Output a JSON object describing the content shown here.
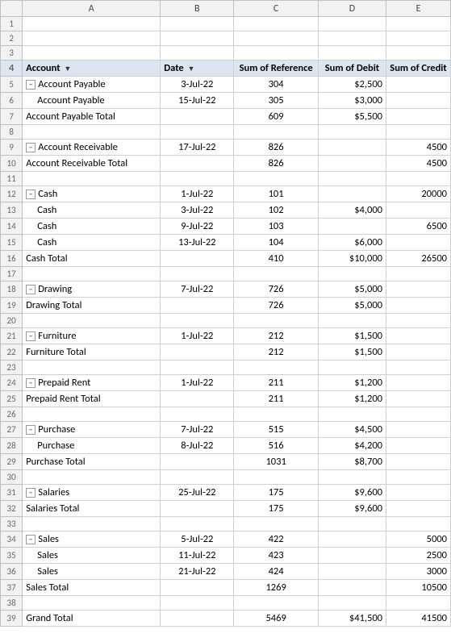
{
  "columns": {
    "rownum": "#",
    "a": "A",
    "b": "B",
    "c": "C",
    "d": "D",
    "e": "E"
  },
  "header": {
    "account": "Account",
    "date": "Date",
    "sum_ref": "Sum of Reference",
    "sum_debit": "Sum of Debit",
    "sum_credit": "Sum of Credit"
  },
  "rows": [
    {
      "num": "1",
      "type": "empty"
    },
    {
      "num": "2",
      "type": "empty"
    },
    {
      "num": "3",
      "type": "empty"
    },
    {
      "num": "4",
      "type": "header"
    },
    {
      "num": "5",
      "type": "account_group",
      "a": "Account Payable",
      "b": "3-Jul-22",
      "c": "304",
      "d": "$2,500",
      "e": ""
    },
    {
      "num": "6",
      "type": "account_sub",
      "a": "Account Payable",
      "b": "15-Jul-22",
      "c": "305",
      "d": "$3,000",
      "e": ""
    },
    {
      "num": "7",
      "type": "total",
      "a": "Account Payable  Total",
      "b": "",
      "c": "609",
      "d": "$5,500",
      "e": ""
    },
    {
      "num": "8",
      "type": "empty"
    },
    {
      "num": "9",
      "type": "account_group",
      "a": "Account Receivable",
      "b": "17-Jul-22",
      "c": "826",
      "d": "",
      "e": "4500"
    },
    {
      "num": "10",
      "type": "total",
      "a": "Account Receivable  Total",
      "b": "",
      "c": "826",
      "d": "",
      "e": "4500"
    },
    {
      "num": "11",
      "type": "empty"
    },
    {
      "num": "12",
      "type": "account_group",
      "a": "Cash",
      "b": "1-Jul-22",
      "c": "101",
      "d": "",
      "e": "20000"
    },
    {
      "num": "13",
      "type": "account_sub",
      "a": "Cash",
      "b": "3-Jul-22",
      "c": "102",
      "d": "$4,000",
      "e": ""
    },
    {
      "num": "14",
      "type": "account_sub",
      "a": "Cash",
      "b": "9-Jul-22",
      "c": "103",
      "d": "",
      "e": "6500"
    },
    {
      "num": "15",
      "type": "account_sub",
      "a": "Cash",
      "b": "13-Jul-22",
      "c": "104",
      "d": "$6,000",
      "e": ""
    },
    {
      "num": "16",
      "type": "total",
      "a": "Cash  Total",
      "b": "",
      "c": "410",
      "d": "$10,000",
      "e": "26500"
    },
    {
      "num": "17",
      "type": "empty"
    },
    {
      "num": "18",
      "type": "account_group",
      "a": "Drawing",
      "b": "7-Jul-22",
      "c": "726",
      "d": "$5,000",
      "e": ""
    },
    {
      "num": "19",
      "type": "total",
      "a": "Drawing  Total",
      "b": "",
      "c": "726",
      "d": "$5,000",
      "e": ""
    },
    {
      "num": "20",
      "type": "empty"
    },
    {
      "num": "21",
      "type": "account_group",
      "a": "Furniture",
      "b": "1-Jul-22",
      "c": "212",
      "d": "$1,500",
      "e": ""
    },
    {
      "num": "22",
      "type": "total",
      "a": "Furniture  Total",
      "b": "",
      "c": "212",
      "d": "$1,500",
      "e": ""
    },
    {
      "num": "23",
      "type": "empty"
    },
    {
      "num": "24",
      "type": "account_group",
      "a": "Prepaid Rent",
      "b": "1-Jul-22",
      "c": "211",
      "d": "$1,200",
      "e": ""
    },
    {
      "num": "25",
      "type": "total",
      "a": "Prepaid Rent  Total",
      "b": "",
      "c": "211",
      "d": "$1,200",
      "e": ""
    },
    {
      "num": "26",
      "type": "empty"
    },
    {
      "num": "27",
      "type": "account_group",
      "a": "Purchase",
      "b": "7-Jul-22",
      "c": "515",
      "d": "$4,500",
      "e": ""
    },
    {
      "num": "28",
      "type": "account_sub",
      "a": "Purchase",
      "b": "8-Jul-22",
      "c": "516",
      "d": "$4,200",
      "e": ""
    },
    {
      "num": "29",
      "type": "total",
      "a": "Purchase  Total",
      "b": "",
      "c": "1031",
      "d": "$8,700",
      "e": ""
    },
    {
      "num": "30",
      "type": "empty"
    },
    {
      "num": "31",
      "type": "account_group",
      "a": "Salaries",
      "b": "25-Jul-22",
      "c": "175",
      "d": "$9,600",
      "e": ""
    },
    {
      "num": "32",
      "type": "total",
      "a": "Salaries  Total",
      "b": "",
      "c": "175",
      "d": "$9,600",
      "e": ""
    },
    {
      "num": "33",
      "type": "empty"
    },
    {
      "num": "34",
      "type": "account_group",
      "a": "Sales",
      "b": "5-Jul-22",
      "c": "422",
      "d": "",
      "e": "5000"
    },
    {
      "num": "35",
      "type": "account_sub",
      "a": "Sales",
      "b": "11-Jul-22",
      "c": "423",
      "d": "",
      "e": "2500"
    },
    {
      "num": "36",
      "type": "account_sub",
      "a": "Sales",
      "b": "21-Jul-22",
      "c": "424",
      "d": "",
      "e": "3000"
    },
    {
      "num": "37",
      "type": "total",
      "a": "Sales Total",
      "b": "",
      "c": "1269",
      "d": "",
      "e": "10500"
    },
    {
      "num": "38",
      "type": "empty"
    },
    {
      "num": "39",
      "type": "grand_total",
      "a": "Grand Total",
      "b": "",
      "c": "5469",
      "d": "$41,500",
      "e": "41500"
    }
  ],
  "icons": {
    "collapse": "−",
    "filter": "▼"
  }
}
